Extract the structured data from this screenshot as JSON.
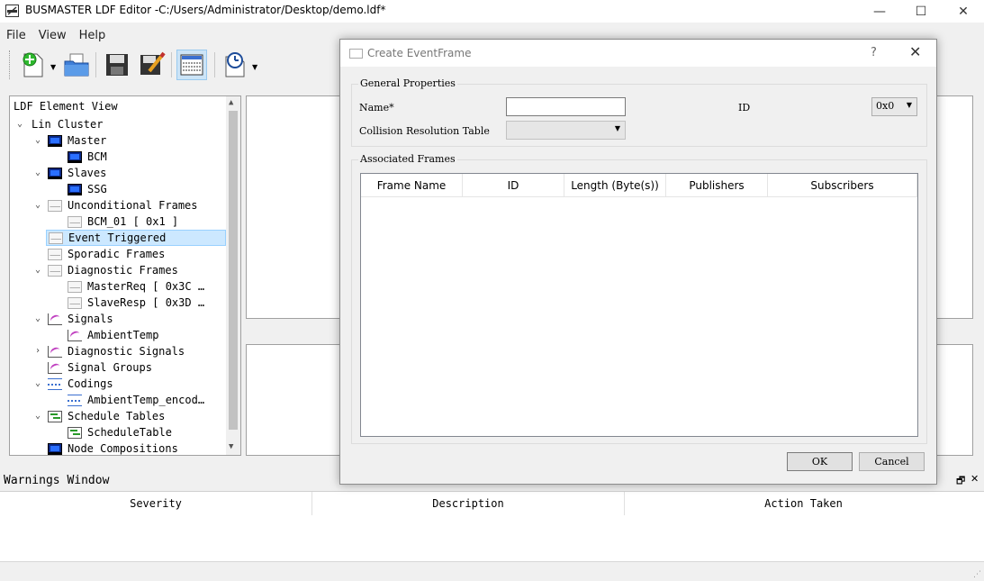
{
  "window": {
    "title": "BUSMASTER LDF Editor -C:/Users/Administrator/Desktop/demo.ldf*",
    "minimize": "—",
    "maximize": "☐",
    "close": "✕"
  },
  "menu": {
    "file": "File",
    "view": "View",
    "help": "Help"
  },
  "tree": {
    "header": "LDF Element View",
    "rows": [
      {
        "label": "Lin Cluster",
        "expander": "⌄",
        "icon": "none"
      },
      {
        "label": "Master",
        "expander": "⌄",
        "icon": "monitor-icon"
      },
      {
        "label": "BCM",
        "expander": "",
        "icon": "monitor-icon"
      },
      {
        "label": "Slaves",
        "expander": "⌄",
        "icon": "monitor-icon"
      },
      {
        "label": "SSG",
        "expander": "",
        "icon": "monitor-icon"
      },
      {
        "label": "Unconditional Frames",
        "expander": "⌄",
        "icon": "envelope-icon"
      },
      {
        "label": "BCM_01 [ 0x1 ]",
        "expander": "",
        "icon": "envelope-icon"
      },
      {
        "label": "Event Triggered",
        "expander": "",
        "icon": "envelope-icon"
      },
      {
        "label": "Sporadic Frames",
        "expander": "",
        "icon": "envelope-icon"
      },
      {
        "label": "Diagnostic Frames",
        "expander": "⌄",
        "icon": "envelope-icon"
      },
      {
        "label": "MasterReq [ 0x3C …",
        "expander": "",
        "icon": "envelope-icon"
      },
      {
        "label": "SlaveResp [ 0x3D …",
        "expander": "",
        "icon": "envelope-icon"
      },
      {
        "label": "Signals",
        "expander": "⌄",
        "icon": "signal-icon"
      },
      {
        "label": "AmbientTemp",
        "expander": "",
        "icon": "signal-icon"
      },
      {
        "label": "Diagnostic Signals",
        "expander": "›",
        "icon": "signal-icon"
      },
      {
        "label": "Signal Groups",
        "expander": "",
        "icon": "signal-icon"
      },
      {
        "label": "Codings",
        "expander": "⌄",
        "icon": "coding-icon"
      },
      {
        "label": "AmbientTemp_encod…",
        "expander": "",
        "icon": "coding-icon"
      },
      {
        "label": "Schedule Tables",
        "expander": "⌄",
        "icon": "schedule-icon"
      },
      {
        "label": "ScheduleTable",
        "expander": "",
        "icon": "schedule-icon"
      },
      {
        "label": "Node Compositions",
        "expander": "",
        "icon": "monitor-icon"
      }
    ]
  },
  "warnings": {
    "title": "Warnings Window",
    "float": "🗗",
    "close": "✕",
    "columns": [
      "Severity",
      "Description",
      "Action Taken"
    ]
  },
  "dialog": {
    "title": "Create EventFrame",
    "help": "?",
    "close": "✕",
    "general": {
      "label": "General Properties",
      "name_label": "Name*",
      "name_value": "",
      "id_label": "ID",
      "id_value": "0x0",
      "crt_label": "Collision Resolution Table",
      "crt_value": ""
    },
    "associated": {
      "label": "Associated Frames",
      "columns": [
        "Frame Name",
        "ID",
        "Length (Byte(s))",
        "Publishers",
        "Subscribers"
      ]
    },
    "ok": "OK",
    "cancel": "Cancel"
  }
}
